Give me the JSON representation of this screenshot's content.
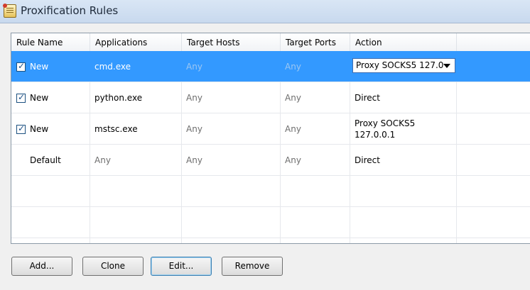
{
  "window": {
    "title": "Proxification Rules"
  },
  "table": {
    "columns": [
      "Rule Name",
      "Applications",
      "Target Hosts",
      "Target Ports",
      "Action"
    ],
    "rows": [
      {
        "checked": true,
        "name": "New",
        "app": "cmd.exe",
        "hosts": "Any",
        "ports": "Any",
        "action": "Proxy SOCKS5 127.0",
        "selected": true
      },
      {
        "checked": true,
        "name": "New",
        "app": "python.exe",
        "hosts": "Any",
        "ports": "Any",
        "action": "Direct"
      },
      {
        "checked": true,
        "name": "New",
        "app": "mstsc.exe",
        "hosts": "Any",
        "ports": "Any",
        "action": "Proxy SOCKS5\n127.0.0.1"
      },
      {
        "checked": null,
        "name": "Default",
        "app": "Any",
        "hosts": "Any",
        "ports": "Any",
        "action": "Direct"
      }
    ]
  },
  "buttons": {
    "add": "Add...",
    "clone": "Clone",
    "edit": "Edit...",
    "remove": "Remove"
  },
  "colors": {
    "selection": "#3399ff",
    "titlebar": "#c8d9ee"
  },
  "icons": {
    "app": "proxifier-rules-icon",
    "dropdown": "chevron-down-icon"
  }
}
